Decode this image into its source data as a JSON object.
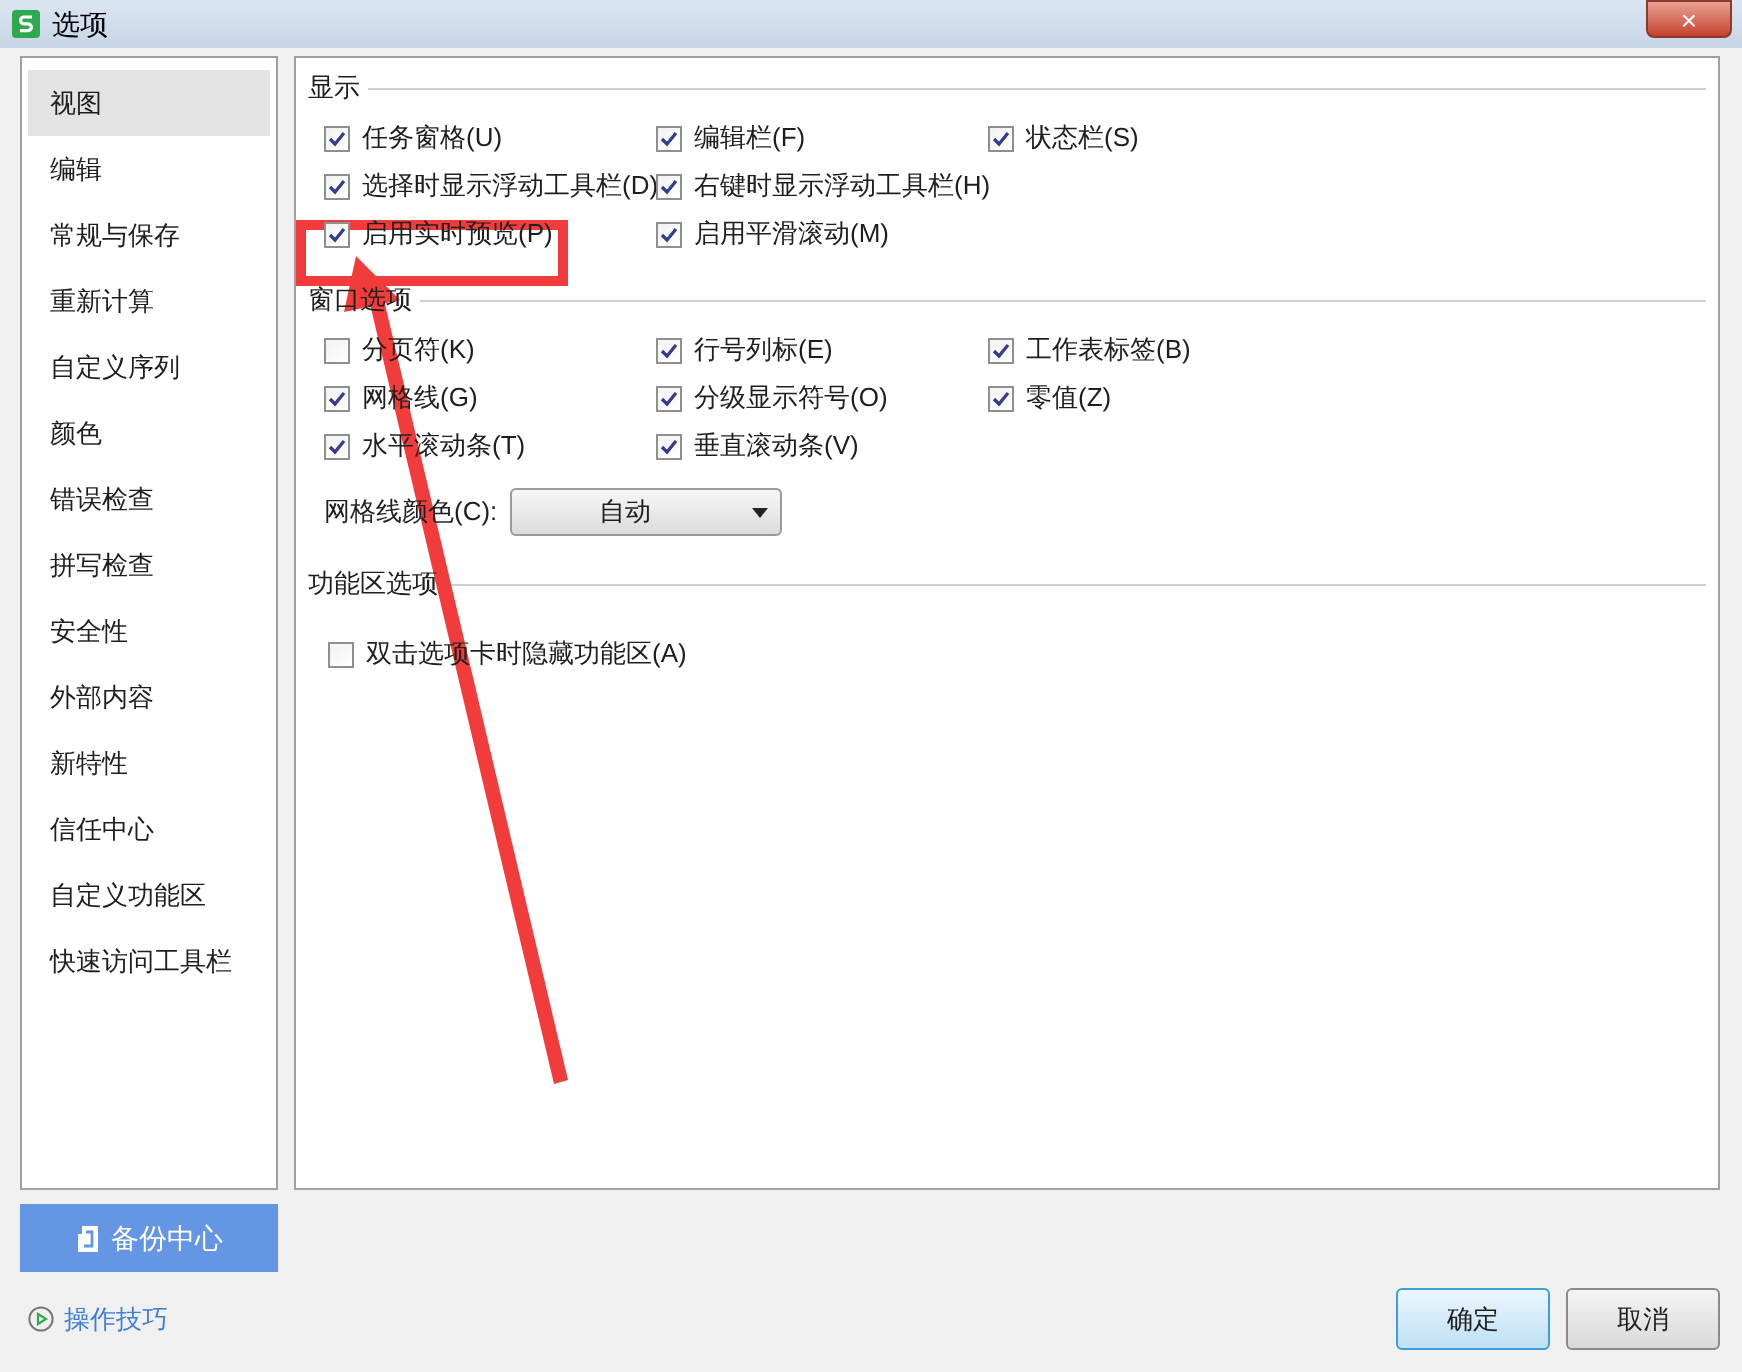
{
  "window": {
    "title": "选项",
    "close": "×"
  },
  "sidebar": {
    "items": [
      {
        "label": "视图",
        "selected": true
      },
      {
        "label": "编辑",
        "selected": false
      },
      {
        "label": "常规与保存",
        "selected": false
      },
      {
        "label": "重新计算",
        "selected": false
      },
      {
        "label": "自定义序列",
        "selected": false
      },
      {
        "label": "颜色",
        "selected": false
      },
      {
        "label": "错误检查",
        "selected": false
      },
      {
        "label": "拼写检查",
        "selected": false
      },
      {
        "label": "安全性",
        "selected": false
      },
      {
        "label": "外部内容",
        "selected": false
      },
      {
        "label": "新特性",
        "selected": false
      },
      {
        "label": "信任中心",
        "selected": false
      },
      {
        "label": "自定义功能区",
        "selected": false
      },
      {
        "label": "快速访问工具栏",
        "selected": false
      }
    ]
  },
  "sections": [
    {
      "title": "显示",
      "rows": [
        [
          {
            "kind": "checkbox",
            "label": "任务窗格(U)",
            "checked": true
          },
          {
            "kind": "checkbox",
            "label": "编辑栏(F)",
            "checked": true
          },
          {
            "kind": "checkbox",
            "label": "状态栏(S)",
            "checked": true
          }
        ],
        [
          {
            "kind": "checkbox",
            "label": "选择时显示浮动工具栏(D)",
            "checked": true
          },
          {
            "kind": "checkbox",
            "label": "右键时显示浮动工具栏(H)",
            "checked": true
          }
        ],
        [
          {
            "kind": "checkbox",
            "label": "启用实时预览(P)",
            "checked": true
          },
          {
            "kind": "checkbox",
            "label": "启用平滑滚动(M)",
            "checked": true
          }
        ]
      ]
    },
    {
      "title": "窗口选项",
      "rows": [
        [
          {
            "kind": "checkbox",
            "label": "分页符(K)",
            "checked": false
          },
          {
            "kind": "checkbox",
            "label": "行号列标(E)",
            "checked": true
          },
          {
            "kind": "checkbox",
            "label": "工作表标签(B)",
            "checked": true
          }
        ],
        [
          {
            "kind": "checkbox",
            "label": "网格线(G)",
            "checked": true
          },
          {
            "kind": "checkbox",
            "label": "分级显示符号(O)",
            "checked": true
          },
          {
            "kind": "checkbox",
            "label": "零值(Z)",
            "checked": true
          }
        ],
        [
          {
            "kind": "checkbox",
            "label": "水平滚动条(T)",
            "checked": true
          },
          {
            "kind": "checkbox",
            "label": "垂直滚动条(V)",
            "checked": true
          }
        ],
        [
          {
            "kind": "dropdown",
            "label": "网格线颜色(C):",
            "value": "自动"
          }
        ]
      ]
    },
    {
      "title": "功能区选项",
      "rows": [
        [
          {
            "kind": "checkbox",
            "label": "双击选项卡时隐藏功能区(A)",
            "checked": false
          }
        ]
      ]
    }
  ],
  "backup_button": "备份中心",
  "tips_link": "操作技巧",
  "buttons": [
    {
      "label": "确定",
      "default": true
    },
    {
      "label": "取消",
      "default": false
    }
  ]
}
